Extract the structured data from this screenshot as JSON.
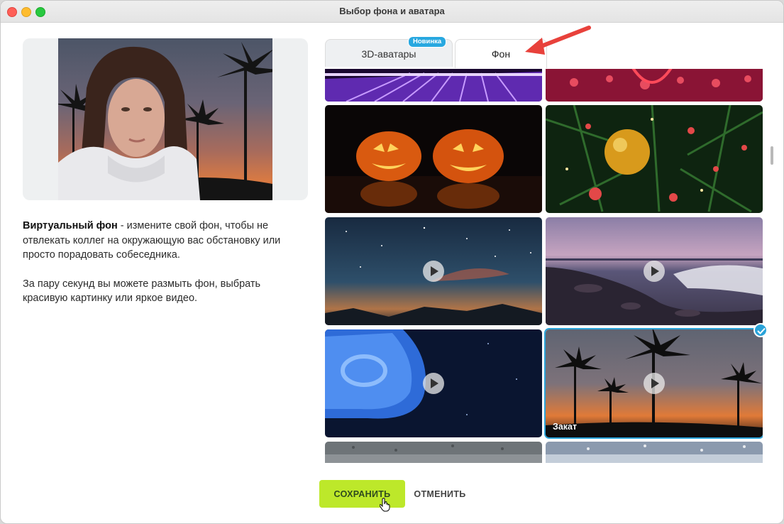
{
  "window": {
    "title": "Выбор фона и аватара"
  },
  "description": {
    "bold": "Виртуальный фон",
    "rest": " - измените свой фон, чтобы не отвлекать коллег на окружающую вас обстановку или просто порадовать собеседника.",
    "para2": "За пару секунд вы можете размыть фон, выбрать красивую картинку или яркое видео."
  },
  "tabs": [
    {
      "label": "3D-аватары",
      "badge": "Новинка",
      "active": false
    },
    {
      "label": "Фон",
      "active": true
    }
  ],
  "backgrounds": [
    {
      "name": "neon-tunnel",
      "video": false
    },
    {
      "name": "neon-lights",
      "video": false
    },
    {
      "name": "pumpkins",
      "video": false
    },
    {
      "name": "christmas-ornament",
      "video": false
    },
    {
      "name": "starry-sky",
      "video": true
    },
    {
      "name": "rocky-shore",
      "video": true
    },
    {
      "name": "jellyfish",
      "video": true
    },
    {
      "name": "sunset",
      "label": "Закат",
      "video": true,
      "selected": true
    },
    {
      "name": "rain-glass",
      "video": false
    },
    {
      "name": "water-drops",
      "video": false
    }
  ],
  "buttons": {
    "save": "СОХРАНИТЬ",
    "cancel": "ОТМЕНИТЬ"
  },
  "colors": {
    "accent_green": "#bde82a",
    "selection_blue": "#29a3d9",
    "badge_blue": "#28a8e0",
    "arrow_red": "#e8413b"
  }
}
